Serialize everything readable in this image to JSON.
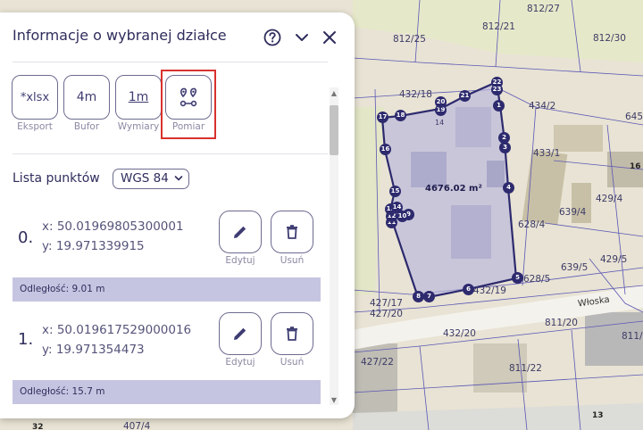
{
  "panel": {
    "title": "Informacje o wybranej działce",
    "tools": [
      {
        "id": "eksport",
        "icon_text": "*xlsx",
        "label": "Eksport"
      },
      {
        "id": "bufor",
        "icon_text": "4m",
        "label": "Bufor"
      },
      {
        "id": "wymiary",
        "icon_text": "1m",
        "label": "Wymiary"
      },
      {
        "id": "pomiar",
        "icon_text": "",
        "label": "Pomiar"
      }
    ],
    "lista_label": "Lista punktów",
    "crs_selected": "WGS 84",
    "points": [
      {
        "index": "0.",
        "x": "x: 50.01969805300001",
        "y": "y: 19.971339915",
        "distance": "Odległość: 9.01 m"
      },
      {
        "index": "1.",
        "x": "x: 50.019617529000016",
        "y": "y: 19.971354473",
        "distance": "Odległość: 15.7 m"
      }
    ],
    "edit_label": "Edytuj",
    "delete_label": "Usuń"
  },
  "icons": {
    "help": "help-circle-icon",
    "collapse": "chevron-down-icon",
    "close": "close-icon",
    "pomiar": "pins-route-icon",
    "edit": "pencil-icon",
    "delete": "trash-icon"
  },
  "colors": {
    "panel_text": "#2f2d5c",
    "accent_border": "#6c6b8f",
    "distance_bar": "#c6c5e1",
    "highlight": "#d8322d",
    "polygon_stroke": "#2d2a6e",
    "polygon_fill": "#b9b7dd"
  },
  "map": {
    "area_label": "4676.02 m²",
    "street": "Włoska",
    "parcels": [
      "812/27",
      "812/21",
      "812/25",
      "812/30",
      "432/18",
      "434/2",
      "645",
      "433/1",
      "16",
      "429/4",
      "639/4",
      "628/4",
      "429/5",
      "639/5",
      "628/5",
      "432/19",
      "427/17",
      "432/20",
      "427/20",
      "811/20",
      "811/2",
      "427/22",
      "811/22",
      "407/4",
      "32",
      "13",
      "14"
    ],
    "vertex_labels": [
      "1",
      "2",
      "3",
      "4",
      "5",
      "6",
      "7",
      "8",
      "9",
      "10",
      "11",
      "12",
      "13",
      "14",
      "15",
      "16",
      "17",
      "18",
      "19",
      "20",
      "21",
      "22",
      "23"
    ]
  }
}
